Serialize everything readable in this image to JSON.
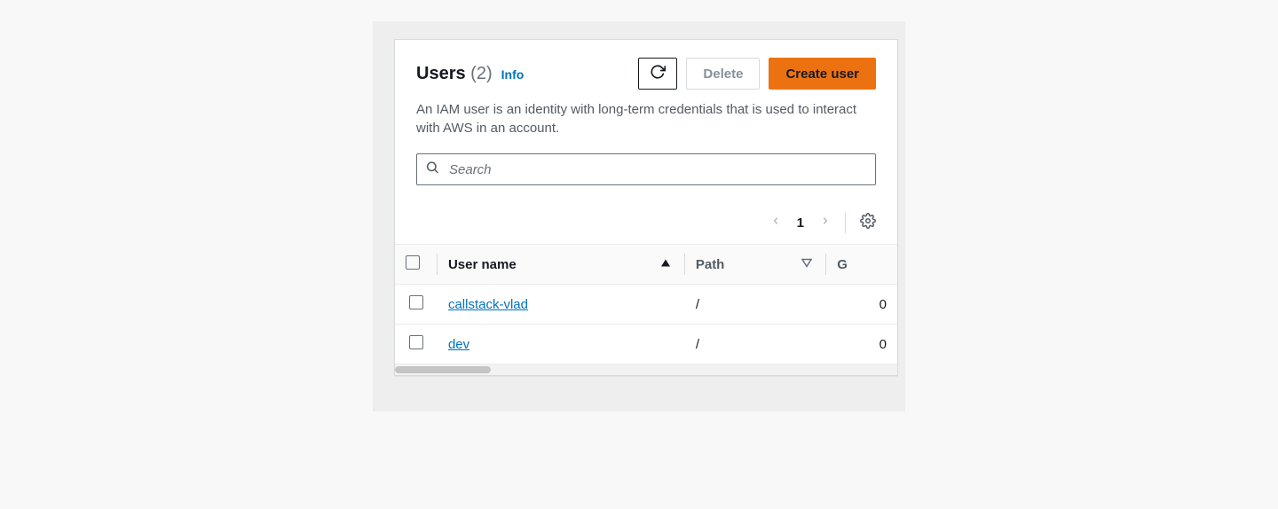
{
  "header": {
    "title": "Users",
    "count": "(2)",
    "info": "Info",
    "description": "An IAM user is an identity with long-term credentials that is used to interact with AWS in an account."
  },
  "actions": {
    "delete": "Delete",
    "create": "Create user"
  },
  "search": {
    "placeholder": "Search"
  },
  "pagination": {
    "page": "1"
  },
  "table": {
    "columns": {
      "username": "User name",
      "path": "Path",
      "extra": "G"
    },
    "rows": [
      {
        "username": "callstack-vlad",
        "path": "/",
        "extra": "0"
      },
      {
        "username": "dev",
        "path": "/",
        "extra": "0"
      }
    ]
  }
}
